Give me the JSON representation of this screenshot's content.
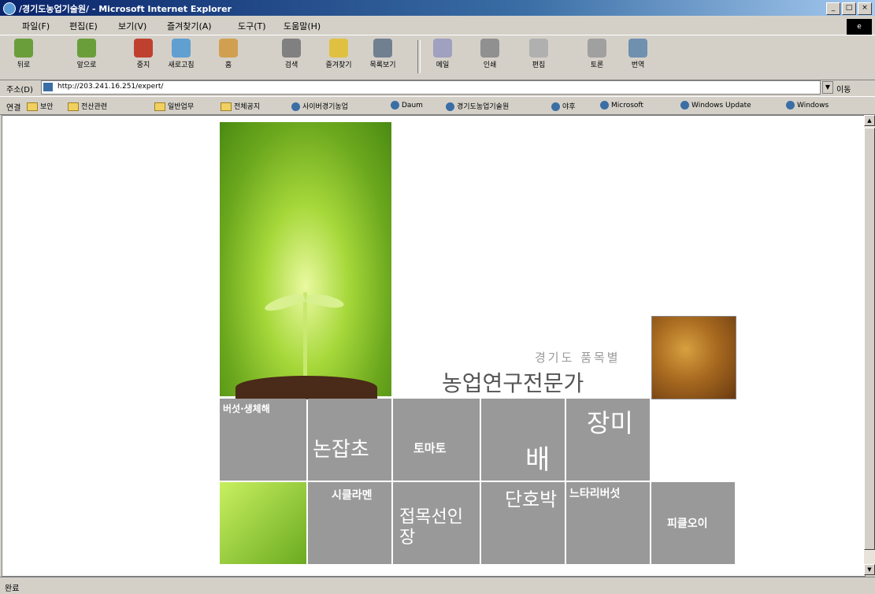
{
  "window": {
    "title": "/경기도농업기술원/ - Microsoft Internet Explorer",
    "buttons": [
      "_",
      "□",
      "×"
    ]
  },
  "menu": [
    "파일(F)",
    "편집(E)",
    "보기(V)",
    "즐겨찾기(A)",
    "도구(T)",
    "도움말(H)"
  ],
  "toolbar": [
    "뒤로",
    "앞으로",
    "중지",
    "새로고침",
    "홈",
    "검색",
    "즐겨찾기",
    "목록보기",
    "메일",
    "인쇄",
    "편집",
    "토론",
    "번역"
  ],
  "address": {
    "label": "주소(D)",
    "url": "http://203.241.16.251/expert/",
    "go": "이동"
  },
  "links": {
    "label": "연결",
    "items": [
      "보안",
      "전산관련",
      "일반업무",
      "전체공지",
      "사이버경기농업",
      "Daum",
      "경기도농업기술원",
      "야후",
      "Microsoft",
      "Windows Update",
      "Windows"
    ]
  },
  "status": "완료",
  "page": {
    "subtitle": "경기도 품목별",
    "title": "농업연구전문가",
    "tiles": {
      "t1": "버섯·생체해",
      "t2": "논잡초",
      "t3": "토마토",
      "t4": "배",
      "t5": "장미",
      "t6": "시클라멘",
      "t7": "접목선인장",
      "t8": "단호박",
      "t9": "느타리버섯",
      "t10": "피클오이"
    }
  }
}
